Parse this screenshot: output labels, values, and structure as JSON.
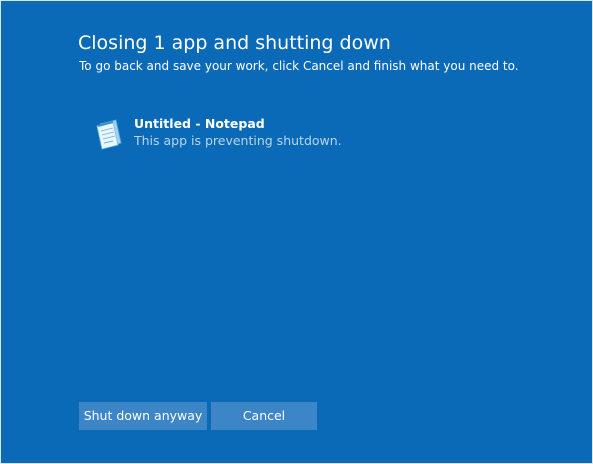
{
  "dialog": {
    "title": "Closing 1 app and shutting down",
    "subtitle": "To go back and save your work, click Cancel and finish what you need to."
  },
  "apps": [
    {
      "name": "Untitled - Notepad",
      "status": "This app is preventing shutdown.",
      "icon": "notepad-icon"
    }
  ],
  "buttons": {
    "shutdown_label": "Shut down anyway",
    "cancel_label": "Cancel"
  },
  "colors": {
    "background": "#0a6ab8",
    "button": "#3c86c8",
    "status_text": "#b8d6ef"
  }
}
